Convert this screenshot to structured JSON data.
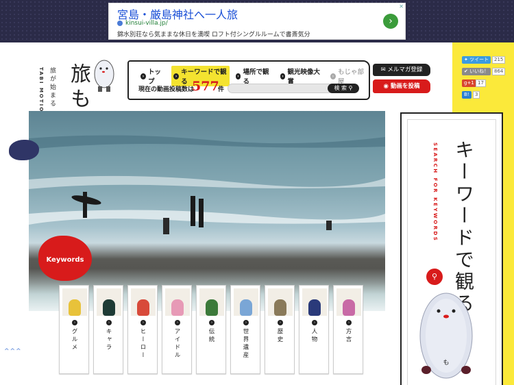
{
  "ad": {
    "title": "宮島・厳島神社へ一人旅",
    "url": "kinsui-villa.jp/",
    "description": "錦水別荘なら気ままな休日を満喫 ロフト付シングルルームで書斎気分",
    "go_icon": "arrow-right-icon",
    "close_label": "✕"
  },
  "logo": {
    "main": "旅もじゃ",
    "sub": "旅が始まる きっかけサイト",
    "latin": "TABI MOTION JAPAN"
  },
  "nav": {
    "items": [
      {
        "label": "トップ",
        "state": "normal"
      },
      {
        "label": "キーワードで観る",
        "state": "active"
      },
      {
        "label": "場所で観る",
        "state": "normal"
      },
      {
        "label": "観光映像大賞",
        "state": "normal"
      },
      {
        "label": "もじゃ部屋",
        "state": "muted"
      }
    ],
    "count_label": "現在の動画投稿数は",
    "count_value": "577",
    "count_unit": "件",
    "search_button": "検 索"
  },
  "actions": {
    "mail_label": "メルマガ登録",
    "post_label": "動画を投稿"
  },
  "social": {
    "tweet_label": "ツイート",
    "tweet_count": "215",
    "like_label": "いいね！",
    "like_count": "864",
    "gplus_label": "g+1",
    "gplus_count": "17",
    "hatena_label": "B!",
    "hatena_count": "3"
  },
  "keywords_badge": "Keywords",
  "categories": [
    {
      "label": "グルメ",
      "color": "#e8c23a"
    },
    {
      "label": "キャラ",
      "color": "#1e3b35"
    },
    {
      "label": "ヒーロー",
      "color": "#d84a3a"
    },
    {
      "label": "アイドル",
      "color": "#e79ab6"
    },
    {
      "label": "伝統",
      "color": "#3c7a3a"
    },
    {
      "label": "世界遺産",
      "color": "#7aa6d6"
    },
    {
      "label": "歴史",
      "color": "#8a7a5a"
    },
    {
      "label": "人物",
      "color": "#2a3a7a"
    },
    {
      "label": "方言",
      "color": "#c86aa6"
    }
  ],
  "keyword_panel": {
    "title": "キーワードで観る",
    "subtitle": "SEARCH FOR KEYWORDS"
  },
  "scroll_hint": "^^^",
  "colors": {
    "accent_red": "#d81b1b",
    "accent_yellow": "#fbe93a",
    "band_navy": "#2b2b48"
  }
}
